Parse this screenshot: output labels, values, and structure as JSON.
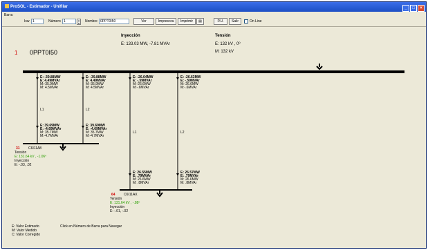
{
  "window": {
    "title": "ProSOL - Estimador - Unifilar"
  },
  "toolbar": {
    "barra_label": "Barra",
    "isw_label": "Isw",
    "isw_value": "1",
    "numero_label": "Número",
    "numero_value": "1",
    "nombre_label": "Nombre",
    "nombre_value": "0PPT0I50",
    "ver_label": "Ver",
    "impresora_label": "Impresora",
    "imprimir_label": "Imprimir",
    "pu_label": "P.U.",
    "salir_label": "Salir",
    "online_label": "On Line"
  },
  "main_bus": {
    "number": "1",
    "name": "0PPT0I50",
    "inyeccion_title": "Inyección",
    "inyeccion_value": "E: 133.03 MW, -7.81 MVAr",
    "tension_title": "Tensión",
    "tension_e": "E: 132 kV , 0º",
    "tension_m": "M: 132 kV"
  },
  "branches": [
    {
      "top": [
        "E: -39.88MW",
        "E: 4.49MVAr",
        "M:-35.9MW",
        "M: 4.5MVAr"
      ],
      "line": "L1",
      "bottom": [
        "E: 39.69MW",
        "E: -4.69MVAr",
        "M: 35.7MW",
        "M:-4.7MVAr"
      ]
    },
    {
      "top": [
        "E: -39.88MW",
        "E: 4.49MVAr",
        "M:-35.9MW",
        "M: 4.5MVAr"
      ],
      "line": "L2",
      "bottom": [
        "E: 39.69MW",
        "E: -4.69MVAr",
        "M: 35.7MW",
        "M:-4.7MVAr"
      ]
    },
    {
      "top": [
        "E: -26.64MW",
        "E: -.59MVAr",
        "M:-26.6MW",
        "M:-.6MVAr"
      ],
      "line": "L1",
      "bottom": [
        "E: 26.55MW",
        "E: .79MVAr",
        "M: 26.6MW",
        "M: .8MVAr"
      ]
    },
    {
      "top": [
        "E: -26.63MW",
        "E: -.59MVAr",
        "M:-26.6MW",
        "M:-.6MVAr"
      ],
      "line": "L2",
      "bottom": [
        "E: 26.57MW",
        "E: .79MVAr",
        "M: 26.6MW",
        "M: .8MVAr"
      ]
    }
  ],
  "sub_bus_1": {
    "number": "31",
    "name": "C6I11A8",
    "tension_label": "Tensión",
    "tension_value": "E: 131.64 kV , -1.06º",
    "inyeccion_label": "Inyección",
    "inyeccion_value": "E: -.03, .02"
  },
  "sub_bus_2": {
    "number": "64",
    "name": "C6I11AX",
    "tension_label": "Tensión",
    "tension_value": "E: 131.64 kV , -.88º",
    "inyeccion_label": "Inyección",
    "inyeccion_value": "E: -.01, -.02"
  },
  "legend": {
    "e": "E: Valor Estimado",
    "m": "M: Valor Medido",
    "c": "C: Valor Corregido",
    "hint": "Click en Número de Barra para Navegar"
  },
  "colors": {
    "title_bar": "#1d4fc4",
    "bus_number": "#d00000",
    "tension_value": "#2aa000"
  }
}
